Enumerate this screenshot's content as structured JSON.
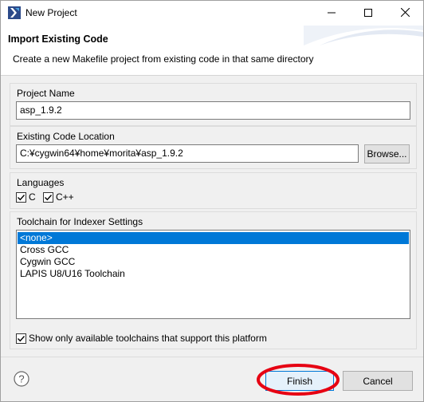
{
  "window": {
    "title": "New Project"
  },
  "header": {
    "title": "Import Existing Code",
    "description": "Create a new Makefile project from existing code in that same directory"
  },
  "project_name": {
    "label": "Project Name",
    "value": "asp_1.9.2"
  },
  "code_location": {
    "label": "Existing Code Location",
    "value": "C:¥cygwin64¥home¥morita¥asp_1.9.2",
    "browse_label": "Browse..."
  },
  "languages": {
    "label": "Languages",
    "items": [
      {
        "label": "C",
        "checked": true
      },
      {
        "label": "C++",
        "checked": true
      }
    ]
  },
  "toolchain": {
    "label": "Toolchain for Indexer Settings",
    "items": [
      {
        "label": "<none>",
        "selected": true
      },
      {
        "label": "Cross GCC",
        "selected": false
      },
      {
        "label": "Cygwin GCC",
        "selected": false
      },
      {
        "label": "LAPIS U8/U16 Toolchain",
        "selected": false
      }
    ],
    "filter_label": "Show only available toolchains that support this platform",
    "filter_checked": true
  },
  "footer": {
    "finish_label": "Finish",
    "cancel_label": "Cancel"
  },
  "colors": {
    "accent": "#0078d7",
    "highlight_annotation": "#e60012"
  }
}
